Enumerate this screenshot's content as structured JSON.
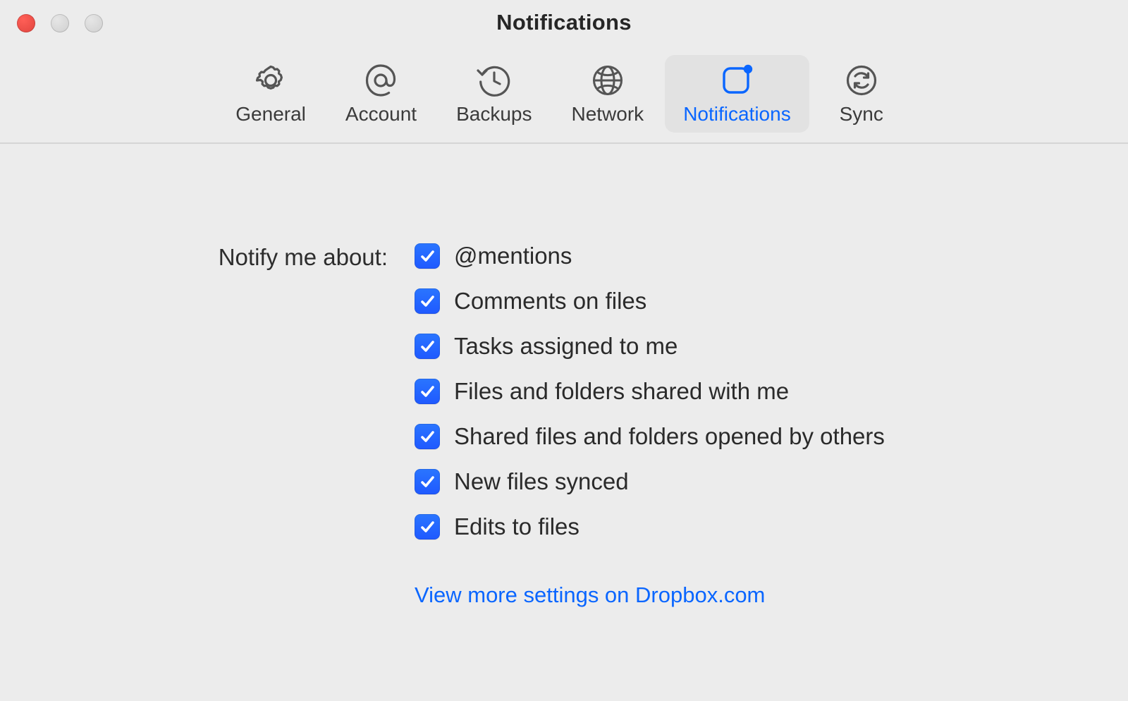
{
  "window": {
    "title": "Notifications"
  },
  "tabs": [
    {
      "key": "general",
      "label": "General",
      "icon": "gear-icon",
      "selected": false
    },
    {
      "key": "account",
      "label": "Account",
      "icon": "at-icon",
      "selected": false
    },
    {
      "key": "backups",
      "label": "Backups",
      "icon": "history-icon",
      "selected": false
    },
    {
      "key": "network",
      "label": "Network",
      "icon": "globe-icon",
      "selected": false
    },
    {
      "key": "notifications",
      "label": "Notifications",
      "icon": "notification-icon",
      "selected": true
    },
    {
      "key": "sync",
      "label": "Sync",
      "icon": "sync-icon",
      "selected": false
    }
  ],
  "section": {
    "label": "Notify me about:",
    "options": [
      {
        "key": "mentions",
        "label": "@mentions",
        "checked": true
      },
      {
        "key": "comments",
        "label": "Comments on files",
        "checked": true
      },
      {
        "key": "tasks",
        "label": "Tasks assigned to me",
        "checked": true
      },
      {
        "key": "shared_with_me",
        "label": "Files and folders shared with me",
        "checked": true
      },
      {
        "key": "opened_by_others",
        "label": "Shared files and folders opened by others",
        "checked": true
      },
      {
        "key": "new_synced",
        "label": "New files synced",
        "checked": true
      },
      {
        "key": "edits",
        "label": "Edits to files",
        "checked": true
      }
    ],
    "more_link": "View more settings on Dropbox.com"
  }
}
